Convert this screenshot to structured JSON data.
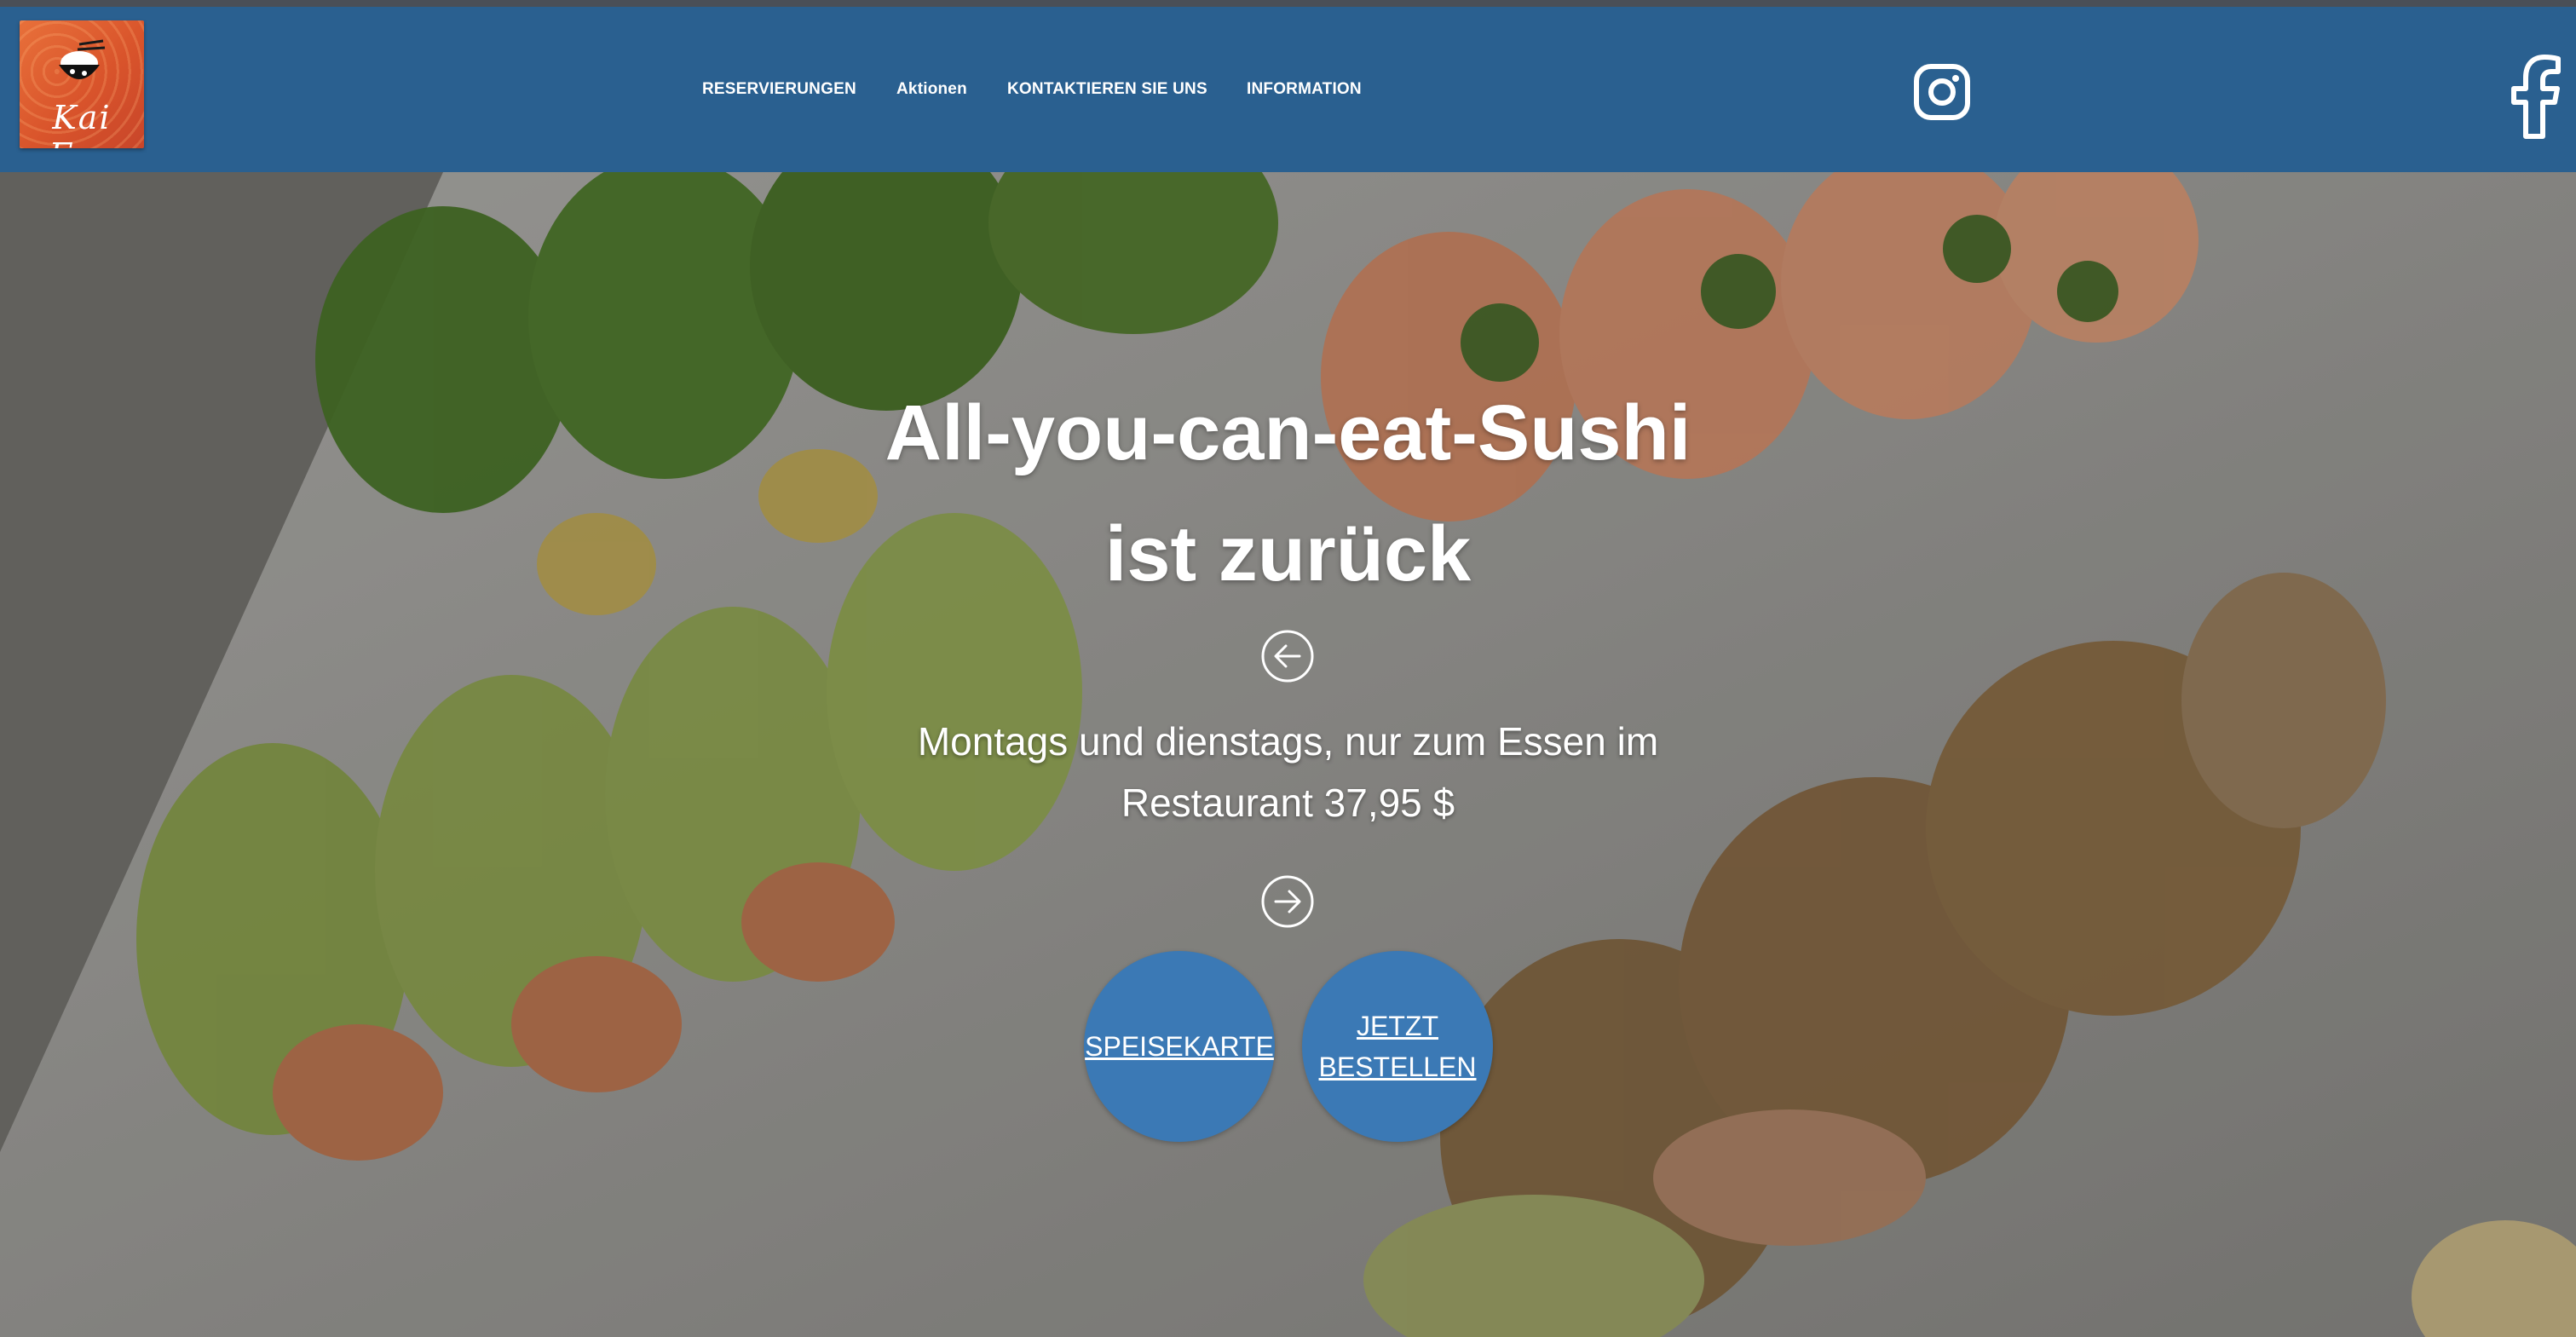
{
  "brand": {
    "logo_text": "Kai Fan"
  },
  "nav": {
    "items": [
      {
        "label": "RESERVIERUNGEN"
      },
      {
        "label": "Aktionen"
      },
      {
        "label": "KONTAKTIEREN SIE UNS"
      },
      {
        "label": "INFORMATION"
      }
    ]
  },
  "social": {
    "instagram_icon": "instagram-icon",
    "facebook_icon": "facebook-icon"
  },
  "hero": {
    "title_line1": "All-you-can-eat-Sushi",
    "title_line2": "ist zurück",
    "subtitle_line1": "Montags und dienstags, nur zum Essen im",
    "subtitle_line2": "Restaurant 37,95 $",
    "prev_icon": "arrow-left-circle-icon",
    "next_icon": "arrow-right-circle-icon",
    "buttons": [
      {
        "label": "SPEISEKARTE"
      },
      {
        "label_line1": "JETZT",
        "label_line2": "BESTELLEN"
      }
    ]
  },
  "colors": {
    "header_bg": "#2a6090",
    "button_bg": "#3b79b5",
    "logo_bg": "#d9542b"
  }
}
